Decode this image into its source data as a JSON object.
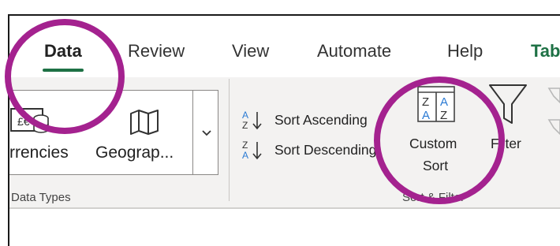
{
  "tabs": {
    "data": "Data",
    "review": "Review",
    "view": "View",
    "automate": "Automate",
    "help": "Help",
    "table": "Tab"
  },
  "data_types": {
    "currencies_label": "rrencies",
    "geography_label": "Geograp...",
    "group_label": "Data Types"
  },
  "sort_filter": {
    "sort_ascending": "Sort Ascending",
    "sort_descending": "Sort Descending",
    "custom_sort_line1": "Custom",
    "custom_sort_line2": "Sort",
    "filter": "Filter",
    "group_label": "Sort & Filter"
  },
  "colors": {
    "accent": "#1e7145",
    "annotation": "#a4228f",
    "ribbon": "#f3f2f1",
    "icon_blue": "#2a7ad3"
  }
}
